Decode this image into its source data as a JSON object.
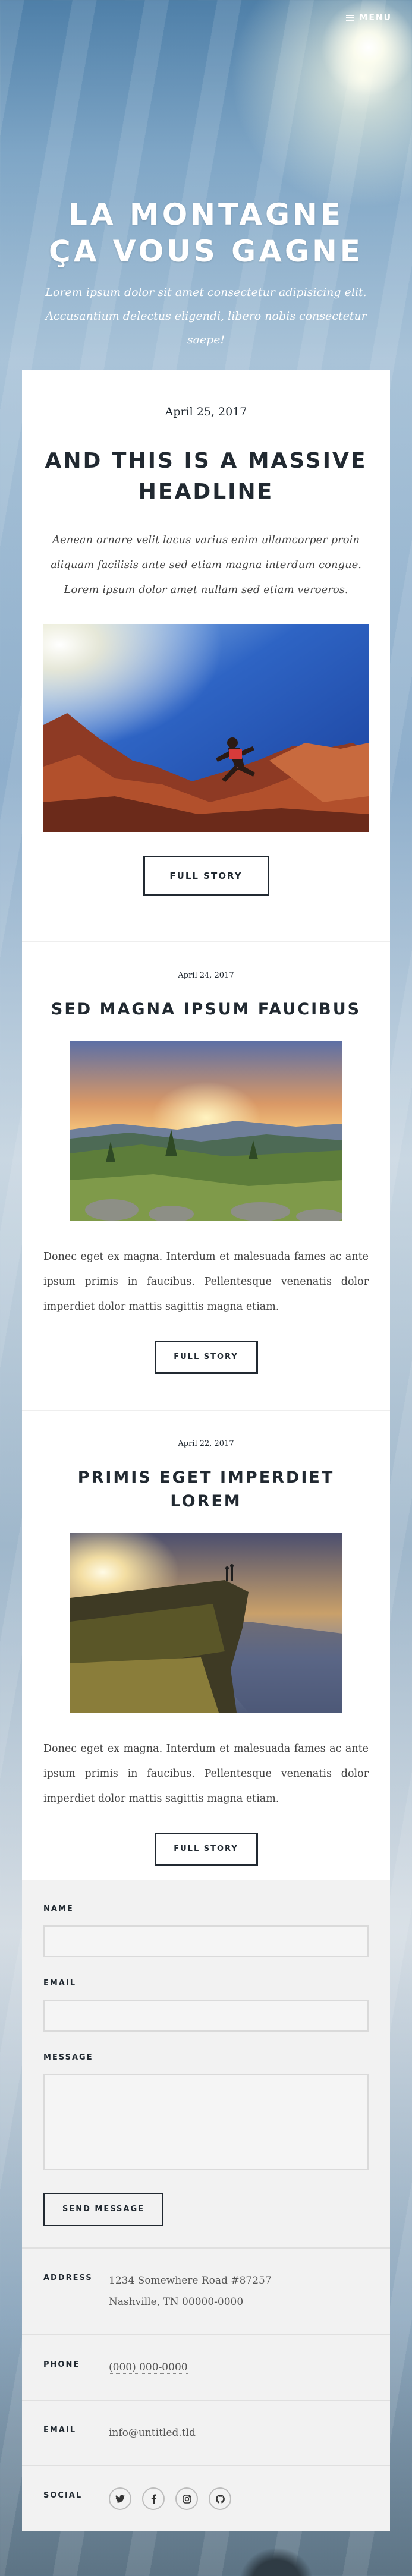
{
  "header": {
    "menu_label": "MENU",
    "hero_title_line1": "LA MONTAGNE",
    "hero_title_line2": "ÇA VOUS GAGNE",
    "hero_subtitle": "Lorem ipsum dolor sit amet consectetur adipisicing elit. Accusantium delectus eligendi, libero nobis consectetur saepe!"
  },
  "posts": [
    {
      "date": "April 25, 2017",
      "title": "And this is a massive headline",
      "lead": "Aenean ornare velit lacus varius enim ullamcorper proin aliquam facilisis ante sed etiam magna interdum congue. Lorem ipsum dolor amet nullam sed etiam veroeros.",
      "button": "Full Story"
    },
    {
      "date": "April 24, 2017",
      "title": "Sed magna ipsum faucibus",
      "excerpt": "Donec eget ex magna. Interdum et malesuada fames ac ante ipsum primis in faucibus. Pellentesque venenatis dolor imperdiet dolor mattis sagittis magna etiam.",
      "button": "Full Story"
    },
    {
      "date": "April 22, 2017",
      "title": "Primis eget imperdiet lorem",
      "excerpt": "Donec eget ex magna. Interdum et malesuada fames ac ante ipsum primis in faucibus. Pellentesque venenatis dolor imperdiet dolor mattis sagittis magna etiam.",
      "button": "Full Story"
    }
  ],
  "form": {
    "name_label": "NAME",
    "name_value": "",
    "email_label": "EMAIL",
    "email_value": "",
    "message_label": "MESSAGE",
    "message_value": "",
    "send_label": "SEND MESSAGE"
  },
  "contact": {
    "address_label": "ADDRESS",
    "address_line1": "1234 Somewhere Road #87257",
    "address_line2": "Nashville, TN 00000-0000",
    "phone_label": "PHONE",
    "phone_value": "(000) 000-0000",
    "email_label": "EMAIL",
    "email_value": "info@untitled.tld",
    "social_label": "SOCIAL",
    "social_icons": [
      "twitter-icon",
      "facebook-icon",
      "instagram-icon",
      "github-icon"
    ]
  }
}
